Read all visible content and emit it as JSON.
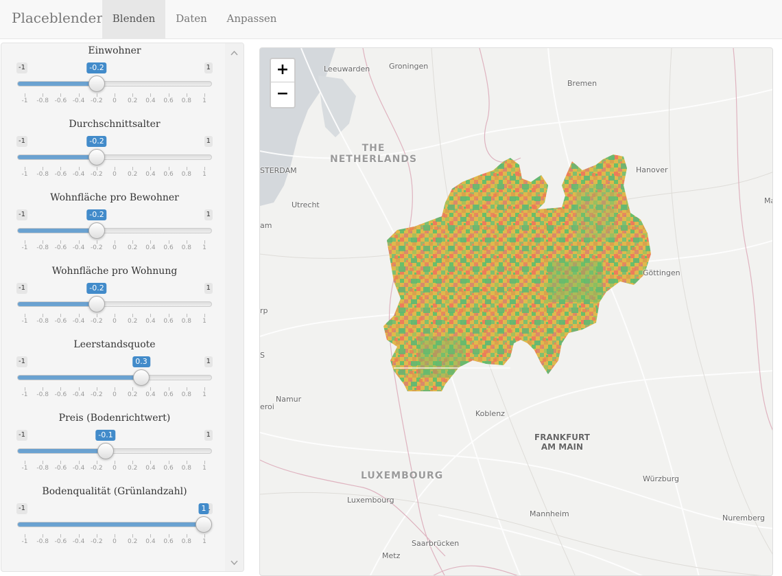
{
  "navbar": {
    "brand": "Placeblender",
    "tabs": [
      {
        "label": "Blenden",
        "active": true
      },
      {
        "label": "Daten",
        "active": false
      },
      {
        "label": "Anpassen",
        "active": false
      }
    ]
  },
  "sliders": [
    {
      "label": "Einwohner",
      "min": "-1",
      "max": "1",
      "value": -0.2,
      "value_label": "-0.2"
    },
    {
      "label": "Durchschnittsalter",
      "min": "-1",
      "max": "1",
      "value": -0.2,
      "value_label": "-0.2"
    },
    {
      "label": "Wohnfläche pro Bewohner",
      "min": "-1",
      "max": "1",
      "value": -0.2,
      "value_label": "-0.2"
    },
    {
      "label": "Wohnfläche pro Wohnung",
      "min": "-1",
      "max": "1",
      "value": -0.2,
      "value_label": "-0.2"
    },
    {
      "label": "Leerstandsquote",
      "min": "-1",
      "max": "1",
      "value": 0.3,
      "value_label": "0.3"
    },
    {
      "label": "Preis (Bodenrichtwert)",
      "min": "-1",
      "max": "1",
      "value": -0.1,
      "value_label": "-0.1"
    },
    {
      "label": "Bodenqualität (Grünlandzahl)",
      "min": "-1",
      "max": "1",
      "value": 1,
      "value_label": "1"
    }
  ],
  "slider_ticks": [
    "-1",
    "-0.8",
    "-0.6",
    "-0.4",
    "-0.2",
    "0",
    "0.2",
    "0.4",
    "0.6",
    "0.8",
    "1"
  ],
  "slider_color": "#428bca",
  "map": {
    "zoom_in": "+",
    "zoom_out": "−",
    "countries": [
      "THE\nNETHERLANDS",
      "LUXEMBOURG"
    ],
    "cities": [
      "Leeuwarden",
      "Groningen",
      "Bremen",
      "Hanover",
      "STERDAM",
      "Utrecht",
      "am",
      "Göttingen",
      "rp",
      "S",
      "Namur",
      "eroi",
      "Koblenz",
      "FRANKFURT\nAM MAIN",
      "Luxembourg",
      "Würzburg",
      "Mannheim",
      "Nuremberg",
      "Saarbrücken",
      "Metz",
      "Ma",
      "E"
    ],
    "region_colors": [
      "#6abf69",
      "#e0b84c",
      "#e88a5a",
      "#a7c05a",
      "#d9a24d",
      "#7fbf6f",
      "#ec7d5b"
    ]
  }
}
